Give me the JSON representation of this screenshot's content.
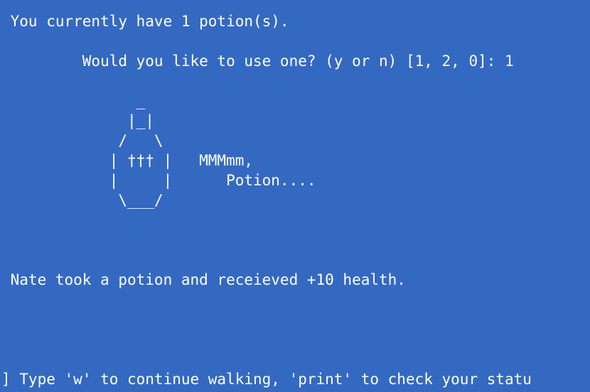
{
  "terminal": {
    "lines": [
      " You currently have 1 potion(s).",
      "         Would you like to use one? (y or n) [1, 2, 0]: 1",
      "               _",
      "              |_|",
      "             /   \\",
      "            | ††† |   MMMmm,",
      "            |     |      Potion....",
      "             \\___/",
      " Nate took a potion and receieved +10 health.",
      "] Type 'w' to continue walking, 'print' to check your statu"
    ]
  },
  "colors": {
    "background": "#3469c2",
    "text": "#ffffff"
  }
}
